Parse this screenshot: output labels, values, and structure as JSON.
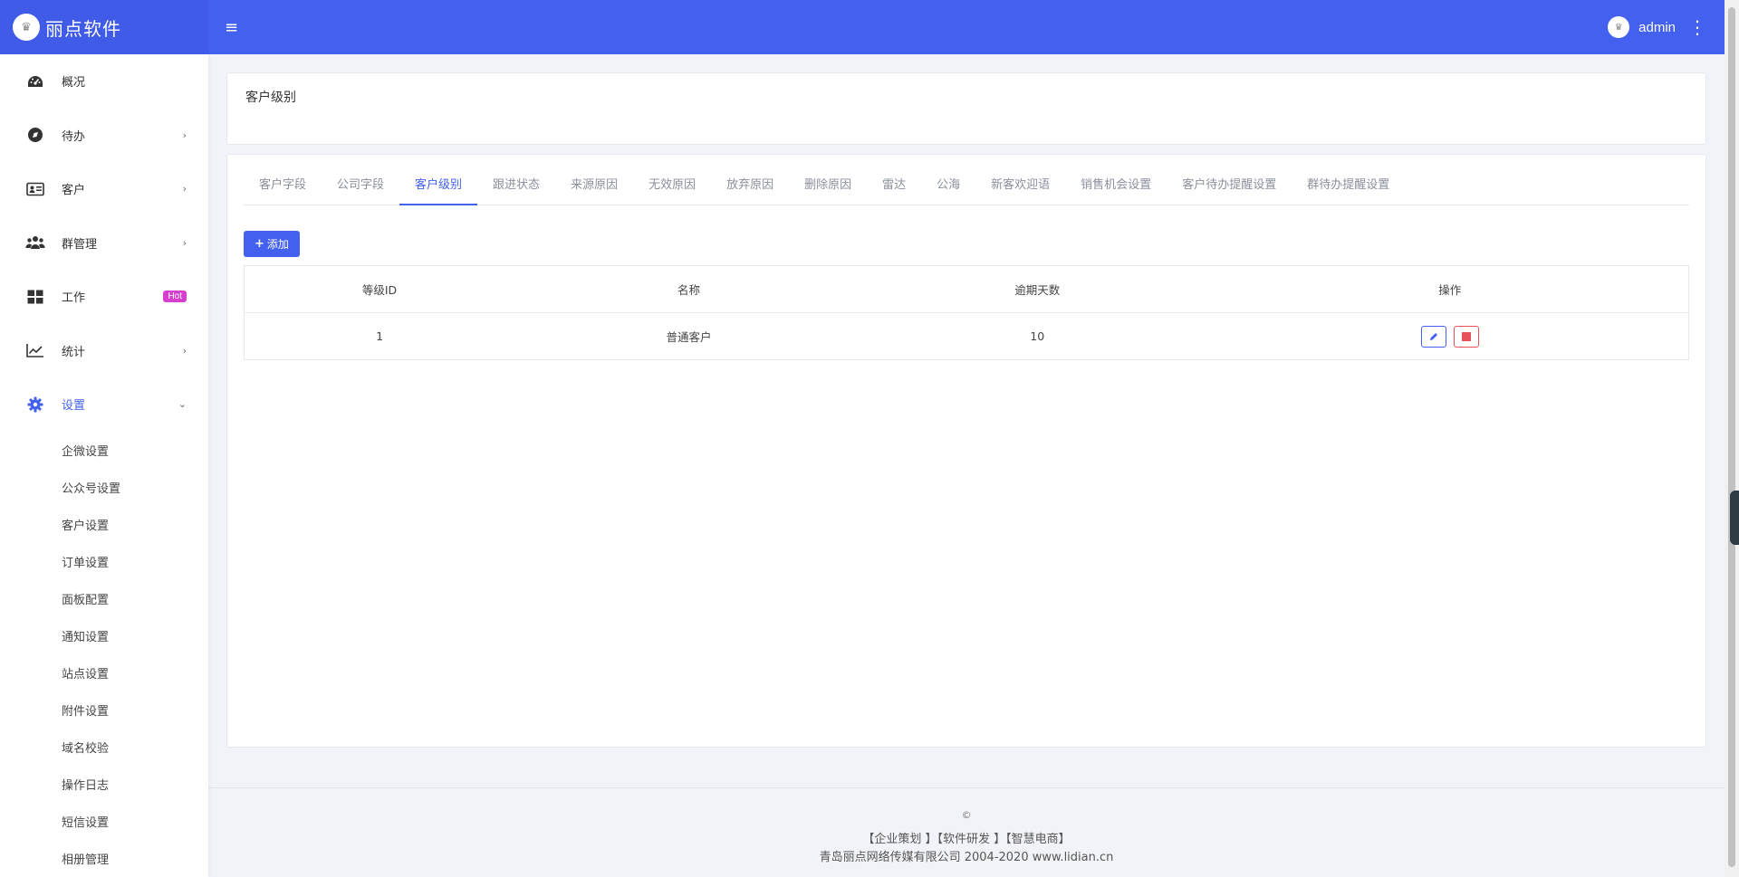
{
  "brand": {
    "name": "丽点软件",
    "logo_icon": "crown-icon"
  },
  "header": {
    "user": "admin"
  },
  "sidebar": {
    "items": [
      {
        "label": "概况",
        "icon": "dashboard-icon"
      },
      {
        "label": "待办",
        "icon": "compass-icon"
      },
      {
        "label": "客户",
        "icon": "id-card-icon"
      },
      {
        "label": "群管理",
        "icon": "users-icon"
      },
      {
        "label": "工作",
        "icon": "grid-icon",
        "badge": "Hot"
      },
      {
        "label": "统计",
        "icon": "chart-line-icon"
      },
      {
        "label": "设置",
        "icon": "gear-icon"
      }
    ],
    "sub_items": [
      "企微设置",
      "公众号设置",
      "客户设置",
      "订单设置",
      "面板配置",
      "通知设置",
      "站点设置",
      "附件设置",
      "域名校验",
      "操作日志",
      "短信设置",
      "相册管理"
    ]
  },
  "page": {
    "title": "客户级别"
  },
  "tabs": [
    "客户字段",
    "公司字段",
    "客户级别",
    "跟进状态",
    "来源原因",
    "无效原因",
    "放弃原因",
    "删除原因",
    "雷达",
    "公海",
    "新客欢迎语",
    "销售机会设置",
    "客户待办提醒设置",
    "群待办提醒设置"
  ],
  "toolbar": {
    "add_label": "添加"
  },
  "table": {
    "headers": [
      "等级ID",
      "名称",
      "逾期天数",
      "操作"
    ],
    "rows": [
      {
        "id": "1",
        "name": "普通客户",
        "days": "10"
      }
    ]
  },
  "footer": {
    "copyright": "©",
    "links": "【企业策划 】【软件研发 】【智慧电商】",
    "company": "青岛丽点网络传媒有限公司 2004-2020 www.lidian.cn"
  },
  "colors": {
    "primary": "#4361ee",
    "danger": "#e7515a",
    "hot": "#d63fce"
  }
}
